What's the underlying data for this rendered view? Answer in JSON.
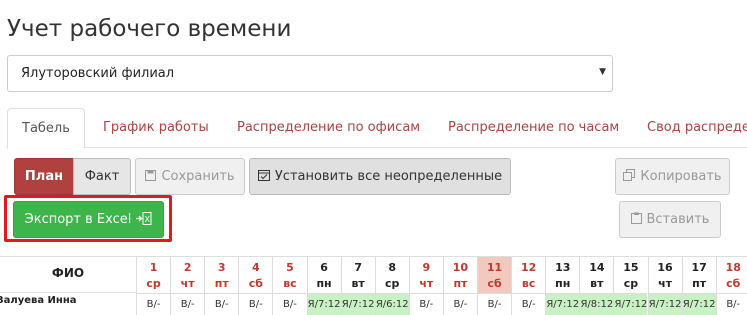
{
  "title": "Учет рабочего времени",
  "branch_select": {
    "value": "Ялуторовский филиал"
  },
  "tabs": [
    "Табель",
    "График работы",
    "Распределение по офисам",
    "Распределение по часам",
    "Свод распреде"
  ],
  "toolbar": {
    "plan": "План",
    "fact": "Факт",
    "save": "Сохранить",
    "set_all": "Установить все неопределенные",
    "copy": "Копировать",
    "export": "Экспорт в Excel",
    "paste": "Вставить"
  },
  "table": {
    "fio_header": "ФИО",
    "employee": "Валуева Инна",
    "days": [
      {
        "d": "1",
        "w": "ср",
        "v": "В/-"
      },
      {
        "d": "2",
        "w": "чт",
        "v": "В/-"
      },
      {
        "d": "3",
        "w": "пт",
        "v": "В/-"
      },
      {
        "d": "4",
        "w": "сб",
        "v": "В/-"
      },
      {
        "d": "5",
        "w": "вс",
        "v": "В/-"
      },
      {
        "d": "6",
        "w": "пн",
        "v": "Я/7:12"
      },
      {
        "d": "7",
        "w": "вт",
        "v": "Я/7:12"
      },
      {
        "d": "8",
        "w": "ср",
        "v": "Я/6:12"
      },
      {
        "d": "9",
        "w": "чт",
        "v": "В/-"
      },
      {
        "d": "10",
        "w": "пт",
        "v": "В/-"
      },
      {
        "d": "11",
        "w": "сб",
        "v": "В/-"
      },
      {
        "d": "12",
        "w": "вс",
        "v": "В/-"
      },
      {
        "d": "13",
        "w": "пн",
        "v": "Я/7:12"
      },
      {
        "d": "14",
        "w": "вт",
        "v": "Я/8:12"
      },
      {
        "d": "15",
        "w": "ср",
        "v": "Я/7:12"
      },
      {
        "d": "16",
        "w": "чт",
        "v": "Я/7:12"
      },
      {
        "d": "17",
        "w": "пт",
        "v": "Я/7:12"
      },
      {
        "d": "18",
        "w": "сб",
        "v": "В/-"
      }
    ]
  }
}
